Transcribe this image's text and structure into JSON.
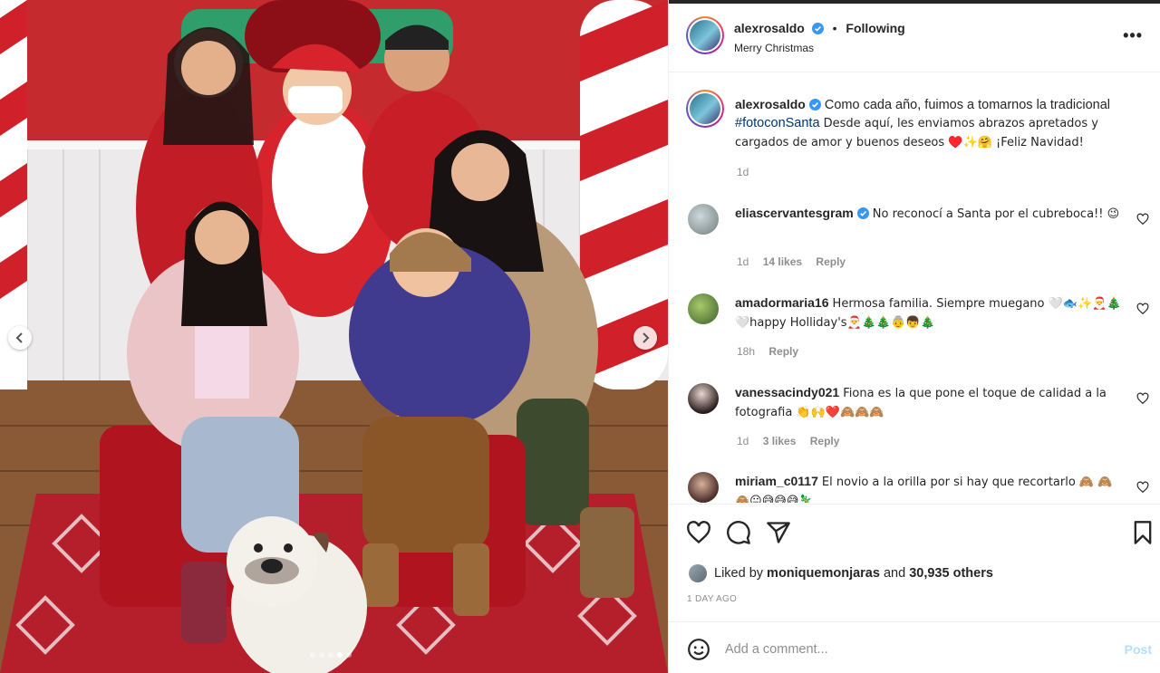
{
  "post": {
    "username": "alexrosaldo",
    "following_label": "Following",
    "separator": "•",
    "location": "Merry Christmas",
    "more_label": "•••",
    "caption": {
      "username": "alexrosaldo",
      "text_before": "Como cada año, fuimos a tomarnos la tradicional",
      "hashtag": "#fotoconSanta",
      "text_after": "Desde aquí, les enviamos abrazos apretados y cargados de amor y buenos deseos ♥️✨🤗 ¡Feliz Navidad!",
      "time": "1d"
    },
    "comments": [
      {
        "username": "eliascervantesgram",
        "verified": true,
        "text": "No reconocí a Santa por el cubreboca!! 😉",
        "time": "1d",
        "likes": "14 likes",
        "reply": "Reply"
      },
      {
        "username": "amadormaria16",
        "verified": false,
        "text": "Hermosa familia. Siempre muegano 🤍🐟✨🎅🎄🤍happy Holliday's🎅🎄🎄👵👦🎄",
        "time": "18h",
        "likes": "",
        "reply": "Reply"
      },
      {
        "username": "vanessacindy021",
        "verified": false,
        "text": "Fiona es la que pone el toque de calidad a la fotografia 👏🙌❤️🙈🙈🙈",
        "time": "1d",
        "likes": "3 likes",
        "reply": "Reply"
      },
      {
        "username": "miriam_c0117",
        "verified": false,
        "text": "El novio a la orilla por si hay que recortarlo 🙈 🙈🙈😐😅😅😅🦎",
        "time": "",
        "likes": "",
        "reply": ""
      }
    ],
    "liked_by": {
      "prefix": "Liked by",
      "user": "moniquemonjaras",
      "middle": "and",
      "others": "30,935 others"
    },
    "date": "1 DAY AGO",
    "add_comment": {
      "placeholder": "Add a comment...",
      "post_label": "Post"
    },
    "carousel": {
      "dots": 5,
      "active_index": 3
    }
  },
  "icons": {
    "verified": "verified-badge-icon",
    "like": "heart-icon",
    "comment": "comment-bubble-icon",
    "share": "paper-plane-icon",
    "save": "bookmark-icon",
    "emoji": "smiley-icon",
    "more": "more-options-icon",
    "prev": "chevron-left-icon",
    "next": "chevron-right-icon"
  },
  "colors": {
    "link": "#00376b",
    "verified": "#3897f0",
    "secondary_text": "#8e8e8e",
    "post_button_disabled": "#b2dffc"
  }
}
